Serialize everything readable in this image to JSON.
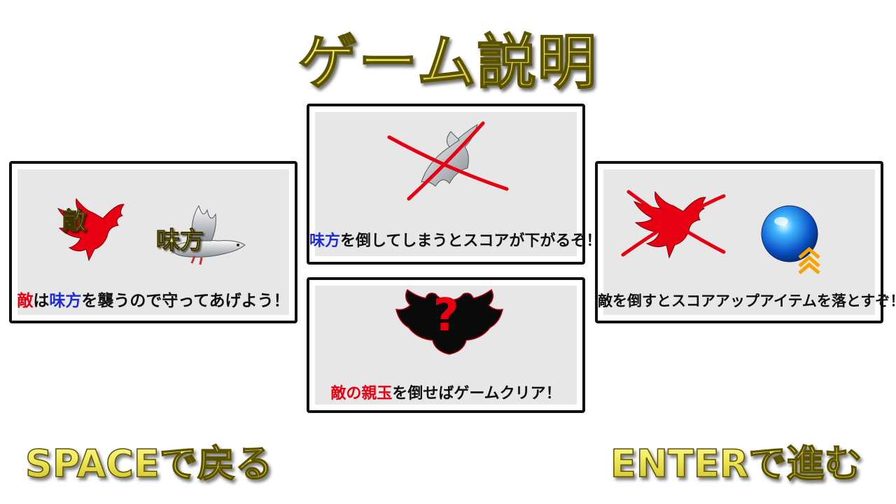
{
  "title": "ゲーム説明",
  "panels": {
    "left": {
      "enemy_tag": "敵",
      "ally_tag": "味方",
      "caption": {
        "p1": "敵",
        "p2": "は",
        "p3": "味方",
        "p4": "を襲うので守ってあげよう！"
      }
    },
    "top_center": {
      "caption": {
        "p1": "味方",
        "p2": "を倒してしまうとスコアが下がるぞ！"
      }
    },
    "bottom_center": {
      "question_mark": "?",
      "caption": {
        "p1": "敵の親玉",
        "p2": "を倒せばゲームクリア！"
      }
    },
    "right": {
      "caption": "敵を倒すとスコアアップアイテムを落とすぞ！"
    }
  },
  "footer": {
    "back": "SPACEで戻る",
    "next": "ENTERで進む"
  },
  "colors": {
    "enemy_red": "#e60012",
    "ally_blue": "#1d2bd8",
    "panel_bg": "#e7e7e7",
    "title_yellow": "#f2ec60"
  },
  "icons": [
    "red-crow-icon",
    "white-dove-icon",
    "cross-mark-icon",
    "black-boss-silhouette-icon",
    "blue-orb-item-icon",
    "score-up-chevron-icon"
  ]
}
